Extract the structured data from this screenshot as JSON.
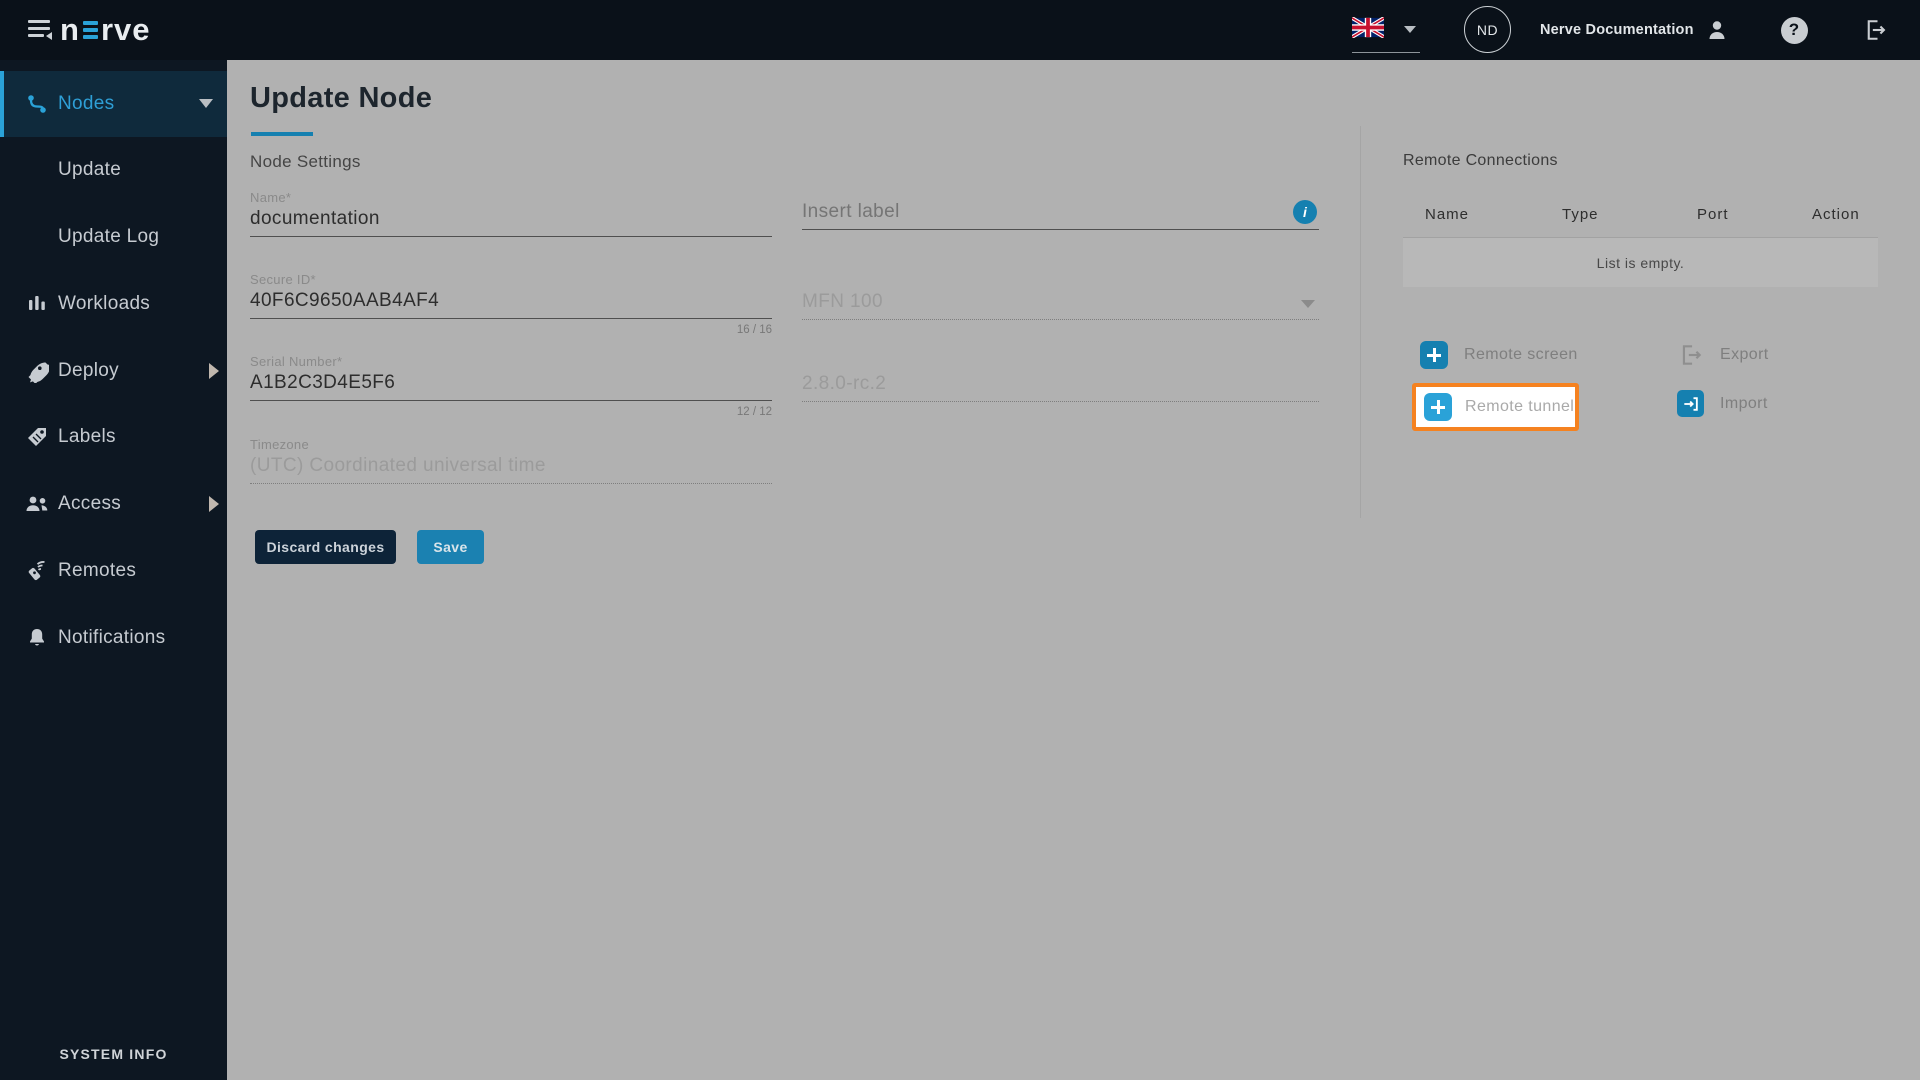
{
  "header": {
    "logo": {
      "pre": "n",
      "post": "rve"
    },
    "language": "en-GB",
    "user_initials": "ND",
    "user_name": "Nerve Documentation"
  },
  "sidebar": {
    "items": [
      {
        "label": "Nodes",
        "active": true,
        "expanded": true
      },
      {
        "label": "Update",
        "sub": true
      },
      {
        "label": "Update Log",
        "sub": true
      },
      {
        "label": "Workloads"
      },
      {
        "label": "Deploy",
        "has_submenu": true
      },
      {
        "label": "Labels"
      },
      {
        "label": "Access",
        "has_submenu": true
      },
      {
        "label": "Remotes"
      },
      {
        "label": "Notifications"
      }
    ],
    "footer_label": "SYSTEM INFO"
  },
  "main": {
    "title": "Update Node",
    "section_title": "Node Settings",
    "fields": {
      "name": {
        "label": "Name*",
        "value": "documentation"
      },
      "secure_id": {
        "label": "Secure ID*",
        "value": "40F6C9650AAB4AF4",
        "counter": "16 / 16"
      },
      "serial_number": {
        "label": "Serial Number*",
        "value": "A1B2C3D4E5F6",
        "counter": "12 / 12"
      },
      "timezone": {
        "label": "Timezone",
        "value": "(UTC) Coordinated universal time"
      },
      "label_input": {
        "placeholder": "Insert label"
      },
      "model": {
        "value": "MFN 100"
      },
      "version": {
        "value": "2.8.0-rc.2"
      }
    },
    "buttons": {
      "discard": "Discard changes",
      "save": "Save"
    }
  },
  "remote_connections": {
    "title": "Remote Connections",
    "columns": [
      "Name",
      "Type",
      "Port",
      "Action"
    ],
    "empty_text": "List is empty.",
    "actions": {
      "remote_screen": "Remote screen",
      "export": "Export",
      "remote_tunnel": "Remote tunnel",
      "import": "Import"
    }
  },
  "colors": {
    "accent_blue": "#2aa2d8",
    "primary_blue": "#1580b0",
    "dark_navy_button": "#0d2338",
    "highlight_orange": "#f58220",
    "header_bg": "#0a1119",
    "sidebar_bg": "#0d1722",
    "content_bg": "#b1b1b1"
  }
}
